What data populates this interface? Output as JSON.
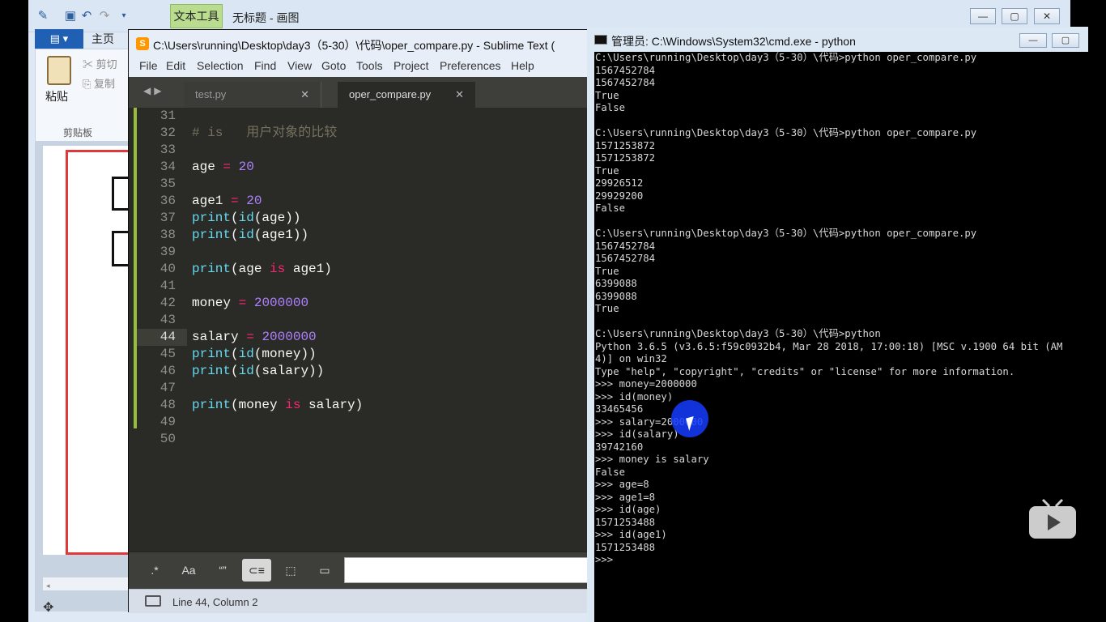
{
  "paint": {
    "contextual_tab": "文本工具",
    "title": "无标题 - 画图",
    "home_tab": "主页",
    "paste_label": "粘贴",
    "cut_label": "剪切",
    "copy_label": "复制",
    "clipboard_group": "剪贴板"
  },
  "sublime": {
    "title": "C:\\Users\\running\\Desktop\\day3（5-30）\\代码\\oper_compare.py - Sublime Text (",
    "menu": [
      "File",
      "Edit",
      "Selection",
      "Find",
      "View",
      "Goto",
      "Tools",
      "Project",
      "Preferences",
      "Help"
    ],
    "tabs": [
      {
        "label": "test.py",
        "active": false
      },
      {
        "label": "oper_compare.py",
        "active": true
      }
    ],
    "line_numbers": [
      "31",
      "32",
      "33",
      "34",
      "35",
      "36",
      "37",
      "38",
      "39",
      "40",
      "41",
      "42",
      "43",
      "44",
      "45",
      "46",
      "47",
      "48",
      "49",
      "50"
    ],
    "active_line": "44",
    "code": {
      "l32_comment": "# is   用户对象的比较",
      "l34_var": "age",
      "l34_op": "=",
      "l34_num": "20",
      "l36_var": "age1",
      "l36_op": "=",
      "l36_num": "20",
      "l37_print": "print",
      "l37_open": "(",
      "l37_id": "id",
      "l37_rest": "(age))",
      "l38_print": "print",
      "l38_open": "(",
      "l38_id": "id",
      "l38_rest": "(age1))",
      "l40_print": "print",
      "l40_a": "(age ",
      "l40_is": "is",
      "l40_b": " age1)",
      "l42_var": "money",
      "l42_op": "=",
      "l42_num": "2000000",
      "l44_var": "salary",
      "l44_op": "=",
      "l44_num": "2000000",
      "l45_print": "print",
      "l45_open": "(",
      "l45_id": "id",
      "l45_rest": "(money))",
      "l46_print": "print",
      "l46_open": "(",
      "l46_id": "id",
      "l46_rest": "(salary))",
      "l48_print": "print",
      "l48_a": "(money ",
      "l48_is": "is",
      "l48_b": " salary)"
    },
    "find_buttons": [
      ".*",
      "Aa",
      "“”",
      "⊂≡",
      "⬚",
      "▭"
    ],
    "status": "Line 44, Column 2"
  },
  "cmd": {
    "title": "管理员: C:\\Windows\\System32\\cmd.exe - python",
    "lines": [
      "C:\\Users\\running\\Desktop\\day3（5-30）\\代码>python oper_compare.py",
      "1567452784",
      "1567452784",
      "True",
      "False",
      "",
      "C:\\Users\\running\\Desktop\\day3（5-30）\\代码>python oper_compare.py",
      "1571253872",
      "1571253872",
      "True",
      "29926512",
      "29929200",
      "False",
      "",
      "C:\\Users\\running\\Desktop\\day3（5-30）\\代码>python oper_compare.py",
      "1567452784",
      "1567452784",
      "True",
      "6399088",
      "6399088",
      "True",
      "",
      "C:\\Users\\running\\Desktop\\day3（5-30）\\代码>python",
      "Python 3.6.5 (v3.6.5:f59c0932b4, Mar 28 2018, 17:00:18) [MSC v.1900 64 bit (AM",
      "4)] on win32",
      "Type \"help\", \"copyright\", \"credits\" or \"license\" for more information.",
      ">>> money=2000000",
      ">>> id(money)",
      "33465456",
      ">>> salary=2000000",
      ">>> id(salary)",
      "39742160",
      ">>> money is salary",
      "False",
      ">>> age=8",
      ">>> age1=8",
      ">>> id(age)",
      "1571253488",
      ">>> id(age1)",
      "1571253488",
      ">>>"
    ]
  },
  "colors": {
    "editor_bg": "#2a2b27",
    "keyword": "#f92672",
    "function": "#66d9ef",
    "number": "#ae81ff",
    "comment": "#75715e",
    "console_text": "#d7d7d7"
  }
}
